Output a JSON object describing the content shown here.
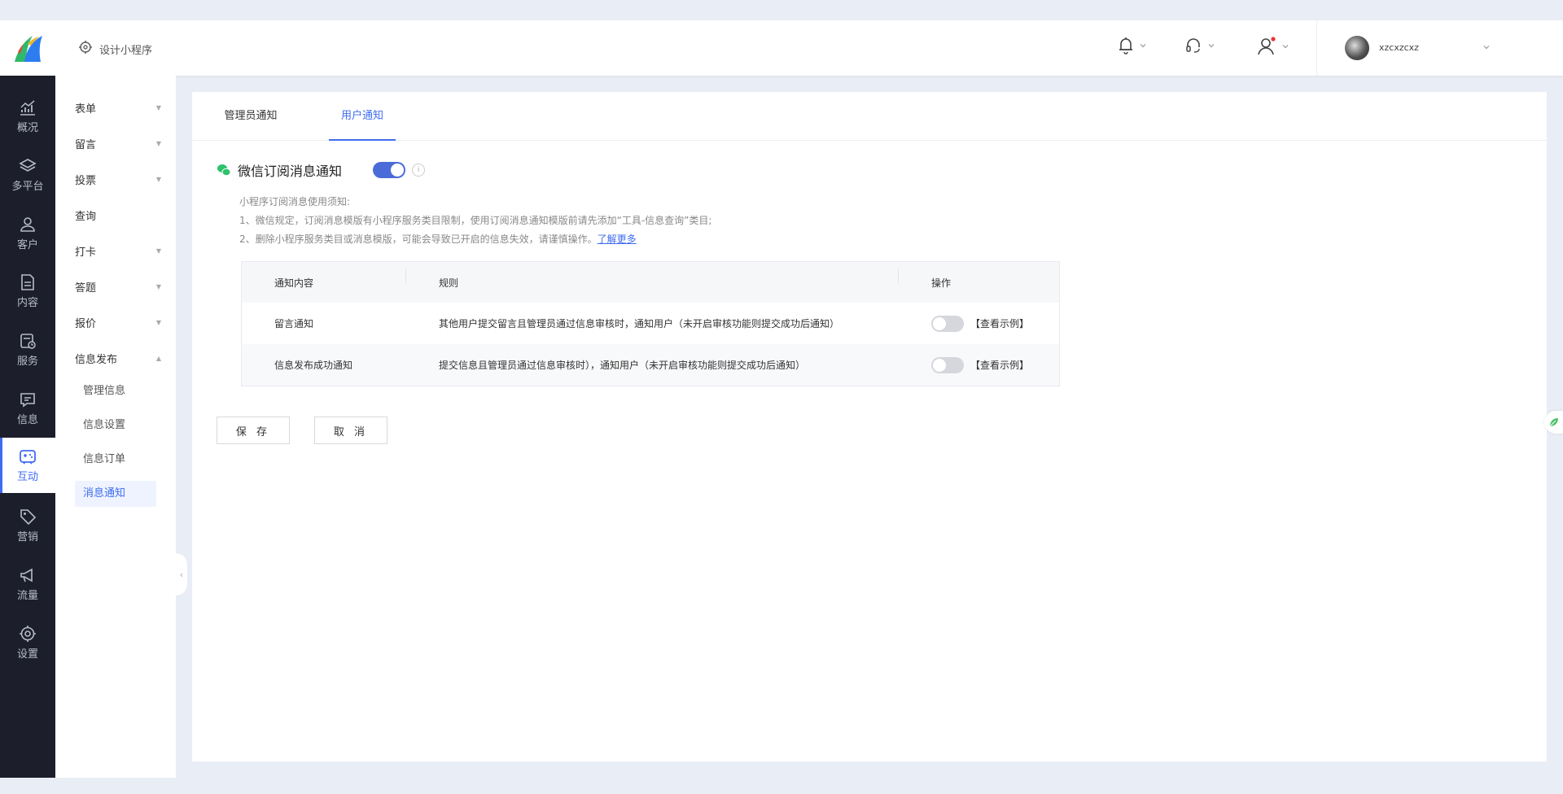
{
  "header": {
    "design_label": "设计小程序",
    "username": "xzcxzcxz"
  },
  "rail": {
    "items": [
      {
        "label": "概况",
        "icon": "chart-icon"
      },
      {
        "label": "多平台",
        "icon": "layers-icon"
      },
      {
        "label": "客户",
        "icon": "user-icon"
      },
      {
        "label": "内容",
        "icon": "document-icon"
      },
      {
        "label": "服务",
        "icon": "service-icon"
      },
      {
        "label": "信息",
        "icon": "message-icon"
      },
      {
        "label": "互动",
        "icon": "gamepad-icon"
      },
      {
        "label": "营销",
        "icon": "tag-icon"
      },
      {
        "label": "流量",
        "icon": "megaphone-icon"
      },
      {
        "label": "设置",
        "icon": "gear-icon"
      }
    ],
    "active": "互动"
  },
  "submenu": {
    "items": [
      {
        "label": "表单"
      },
      {
        "label": "留言"
      },
      {
        "label": "投票"
      },
      {
        "label": "查询"
      },
      {
        "label": "打卡"
      },
      {
        "label": "答题"
      },
      {
        "label": "报价"
      },
      {
        "label": "信息发布"
      }
    ],
    "children": [
      {
        "label": "管理信息"
      },
      {
        "label": "信息设置"
      },
      {
        "label": "信息订单"
      },
      {
        "label": "消息通知"
      }
    ],
    "active_child": "消息通知"
  },
  "tabs": [
    {
      "label": "管理员通知"
    },
    {
      "label": "用户通知"
    }
  ],
  "active_tab": "用户通知",
  "wechat": {
    "title": "微信订阅消息通知",
    "enabled": true,
    "info": "i"
  },
  "tips": {
    "line0": "小程序订阅消息使用须知:",
    "line1": "1、微信规定，订阅消息模版有小程序服务类目限制，使用订阅消息通知模版前请先添加“工具-信息查询”类目;",
    "line2": "2、删除小程序服务类目或消息模版，可能会导致已开启的信息失效，请谨慎操作。",
    "link": "了解更多"
  },
  "table": {
    "headers": {
      "content": "通知内容",
      "rule": "规则",
      "action": "操作"
    },
    "rows": [
      {
        "content": "留言通知",
        "rule": "其他用户提交留言且管理员通过信息审核时，通知用户（未开启审核功能则提交成功后通知）",
        "enabled": false,
        "example": "【查看示例】"
      },
      {
        "content": "信息发布成功通知",
        "rule": "提交信息且管理员通过信息审核时），通知用户（未开启审核功能则提交成功后通知）",
        "enabled": false,
        "example": "【查看示例】"
      }
    ]
  },
  "buttons": {
    "save": "保 存",
    "cancel": "取 消"
  },
  "colors": {
    "accent": "#3f6cf0",
    "rail_bg": "#1c1f2b",
    "toggle_on": "#4b6cd8"
  }
}
